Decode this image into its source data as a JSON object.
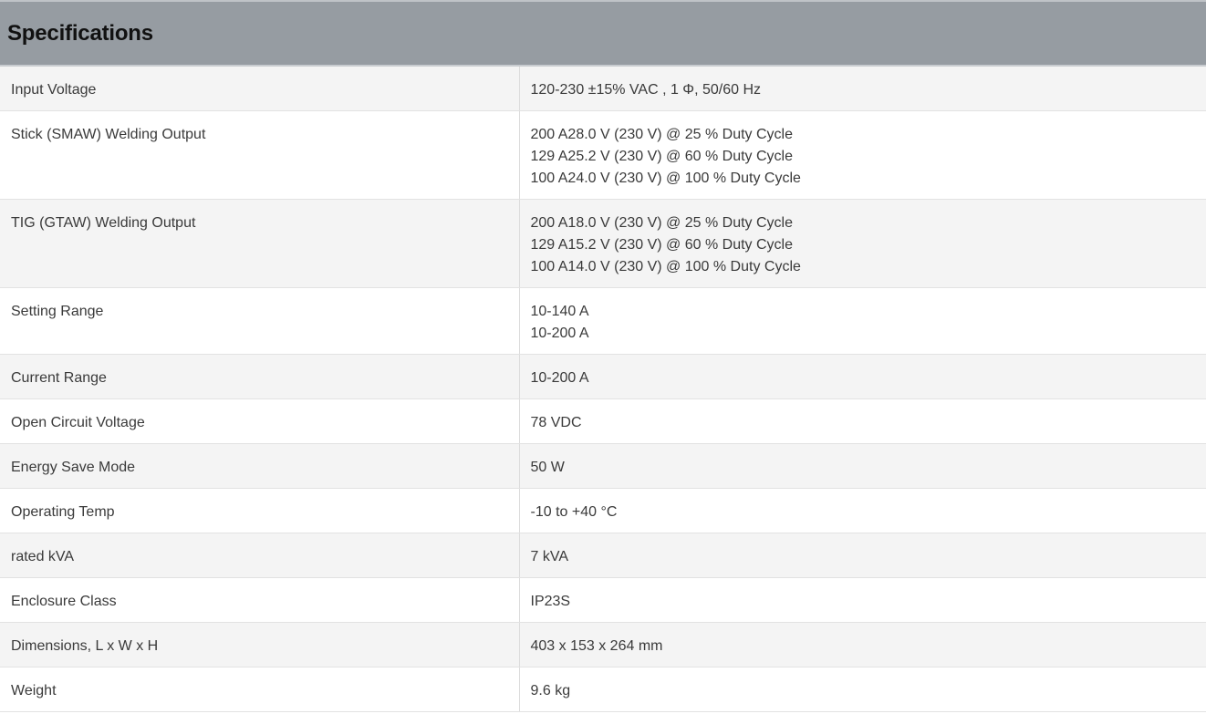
{
  "header": {
    "title": "Specifications"
  },
  "rows": [
    {
      "label": "Input Voltage",
      "values": [
        "120-230 ±15% VAC , 1 Φ, 50/60 Hz"
      ]
    },
    {
      "label": "Stick (SMAW) Welding Output",
      "values": [
        "200 A28.0 V (230 V) @ 25 % Duty Cycle",
        "129 A25.2 V (230 V) @ 60 % Duty Cycle",
        "100 A24.0 V (230 V) @ 100 % Duty Cycle"
      ]
    },
    {
      "label": "TIG (GTAW) Welding Output",
      "values": [
        "200 A18.0 V (230 V) @ 25 % Duty Cycle",
        "129 A15.2 V (230 V) @ 60 % Duty Cycle",
        "100 A14.0 V (230 V) @ 100 % Duty Cycle"
      ]
    },
    {
      "label": "Setting Range",
      "values": [
        "10-140 A",
        "10-200 A"
      ]
    },
    {
      "label": "Current Range",
      "values": [
        "10-200 A"
      ]
    },
    {
      "label": "Open Circuit Voltage",
      "values": [
        "78 VDC"
      ]
    },
    {
      "label": "Energy Save Mode",
      "values": [
        "50 W"
      ]
    },
    {
      "label": "Operating Temp",
      "values": [
        "-10 to +40 °C"
      ]
    },
    {
      "label": "rated kVA",
      "values": [
        "7 kVA"
      ]
    },
    {
      "label": "Enclosure Class",
      "values": [
        "IP23S"
      ]
    },
    {
      "label": "Dimensions, L x W x H",
      "values": [
        "403 x 153 x 264 mm"
      ]
    },
    {
      "label": "Weight",
      "values": [
        "9.6 kg"
      ]
    }
  ]
}
